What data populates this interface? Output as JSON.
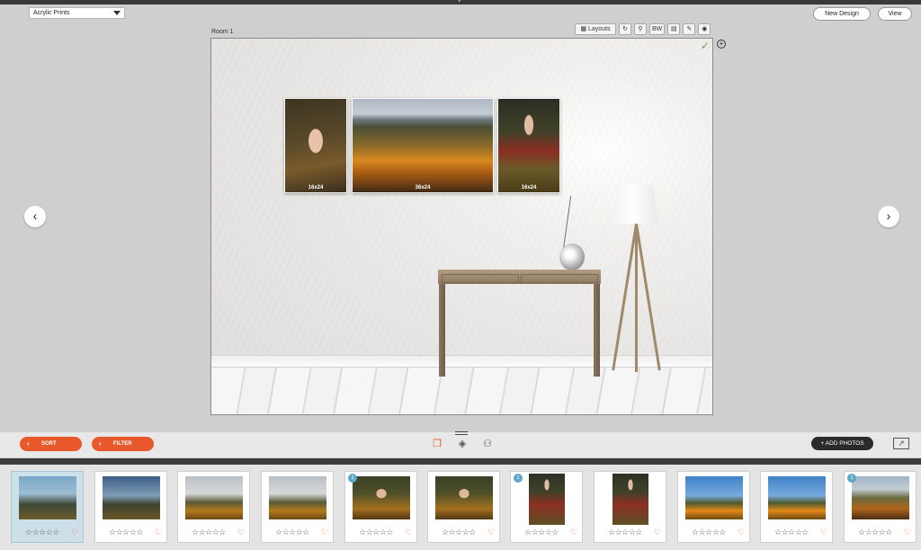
{
  "header": {
    "product_select": "Acrylic Prints",
    "new_design_label": "New Design",
    "view_label": "View"
  },
  "room": {
    "label": "Room 1",
    "toolbar": {
      "layouts_label": "Layouts",
      "bw_label": "BW"
    },
    "prints": [
      {
        "size": "16x24"
      },
      {
        "size": "36x24"
      },
      {
        "size": "16x24"
      }
    ]
  },
  "bottom_bar": {
    "sort_label": "SORT",
    "filter_label": "FILTER",
    "add_photos_label": "+ ADD PHOTOS"
  },
  "filmstrip": {
    "stars": "☆☆☆☆☆",
    "heart": "♡",
    "thumbnails": [
      {
        "count": ""
      },
      {
        "count": ""
      },
      {
        "count": ""
      },
      {
        "count": ""
      },
      {
        "count": "1"
      },
      {
        "count": ""
      },
      {
        "count": "1"
      },
      {
        "count": ""
      },
      {
        "count": ""
      },
      {
        "count": ""
      },
      {
        "count": "1"
      }
    ]
  },
  "icons": {
    "nav_prev": "chevron-left-icon",
    "nav_next": "chevron-right-icon",
    "accent": "#e7582b",
    "badge": "#5ba6c9"
  }
}
